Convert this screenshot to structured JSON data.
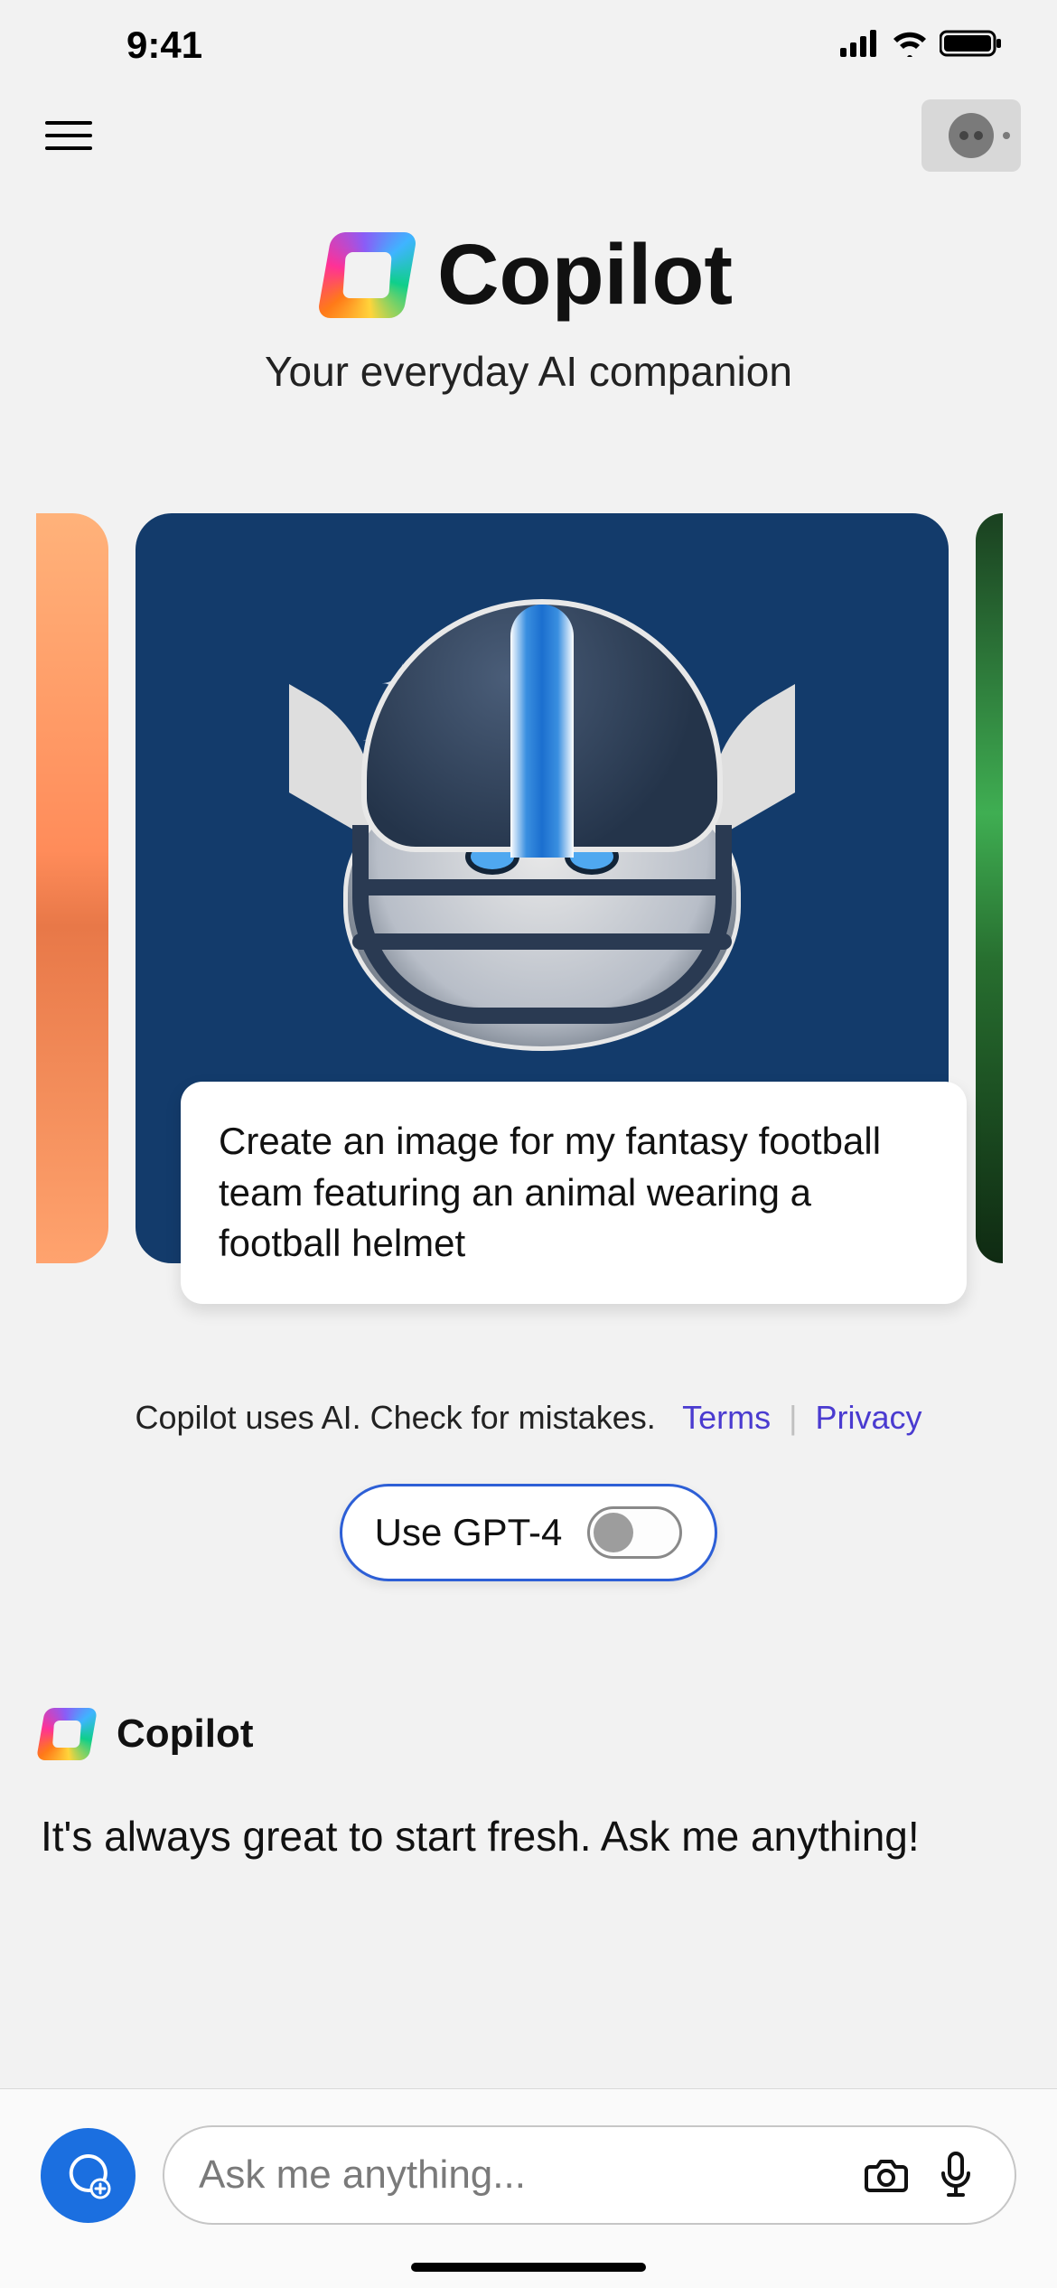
{
  "status": {
    "time": "9:41"
  },
  "header": {
    "title": "Copilot",
    "tagline": "Your everyday AI companion"
  },
  "carousel": {
    "main_prompt": "Create an image for my fantasy football team featuring an animal wearing a football helmet"
  },
  "disclaimer": {
    "text": "Copilot uses AI. Check for mistakes.",
    "terms": "Terms",
    "privacy": "Privacy"
  },
  "gpt_toggle": {
    "label": "Use GPT-4",
    "on": false
  },
  "chat": {
    "name": "Copilot",
    "greeting": "It's always great to start fresh. Ask me anything!"
  },
  "input": {
    "placeholder": "Ask me anything..."
  }
}
